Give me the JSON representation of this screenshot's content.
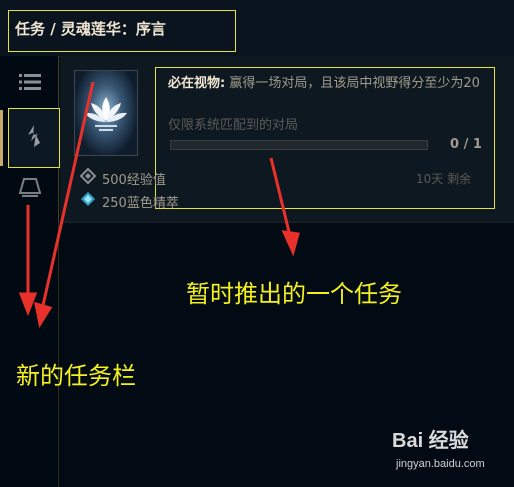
{
  "header": {
    "title": "任务 / 灵魂莲华：序言"
  },
  "sidebar": {
    "items": [
      {
        "icon": "list-icon"
      },
      {
        "icon": "spirit-blossom-icon",
        "active": true
      },
      {
        "icon": "bell-icon"
      }
    ]
  },
  "quest": {
    "title_bold": "必在视物:",
    "title_text": " 赢得一场对局，且该局中视野得分至少为20",
    "subtitle": "仅限系统匹配到的对局",
    "progress_fraction": 0,
    "progress_text": "0 / 1",
    "time_left": "10天 剩余",
    "rewards": [
      {
        "icon": "xp-icon",
        "label": "500经验值"
      },
      {
        "icon": "blue-essence-icon",
        "label": "250蓝色精萃"
      }
    ]
  },
  "annotations": {
    "task_label": "暂时推出的一个任务",
    "sidebar_label": "新的任务栏"
  },
  "watermark": {
    "brand": "Bai 经验",
    "url": "jingyan.baidu.com"
  },
  "colors": {
    "annotation": "#f5f01e",
    "highlight_box": "#e6e23c",
    "arrow": "#e8312a",
    "gold": "#c8aa6e"
  }
}
